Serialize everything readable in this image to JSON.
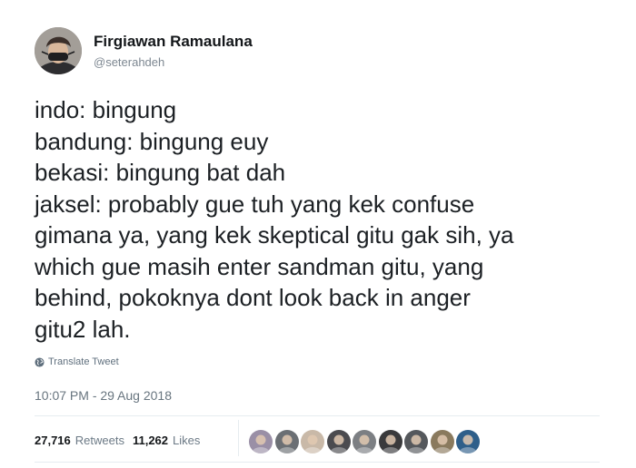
{
  "user": {
    "display_name": "Firgiawan Ramaulana",
    "handle": "@seterahdeh",
    "avatar_icon": "profile-photo"
  },
  "tweet": {
    "lines": [
      "indo: bingung",
      "bandung: bingung euy",
      "bekasi: bingung bat dah",
      "jaksel: probably gue tuh yang kek confuse",
      "gimana ya, yang kek skeptical gitu gak sih, ya",
      "which gue masih enter sandman gitu, yang",
      "behind, pokoknya dont look back in anger",
      "gitu2 lah."
    ],
    "translate_label": "Translate Tweet",
    "translate_icon": "globe-icon",
    "timestamp": "10:07 PM - 29 Aug 2018"
  },
  "stats": {
    "retweets_count": "27,716",
    "retweets_label": "Retweets",
    "likes_count": "11,262",
    "likes_label": "Likes"
  },
  "likers": [
    {
      "icon": "liker-avatar-1",
      "color": "#9a8fa6"
    },
    {
      "icon": "liker-avatar-2",
      "color": "#6b6f74"
    },
    {
      "icon": "liker-avatar-3",
      "color": "#c9b9a8"
    },
    {
      "icon": "liker-avatar-4",
      "color": "#4b4b4f"
    },
    {
      "icon": "liker-avatar-5",
      "color": "#7c7f83"
    },
    {
      "icon": "liker-avatar-6",
      "color": "#3a3a3c"
    },
    {
      "icon": "liker-avatar-7",
      "color": "#55585c"
    },
    {
      "icon": "liker-avatar-8",
      "color": "#8a7a5e"
    },
    {
      "icon": "liker-avatar-9",
      "color": "#2f5f8a"
    }
  ],
  "colors": {
    "text": "#14171a",
    "secondary": "#657786",
    "divider": "#e6ecf0"
  }
}
